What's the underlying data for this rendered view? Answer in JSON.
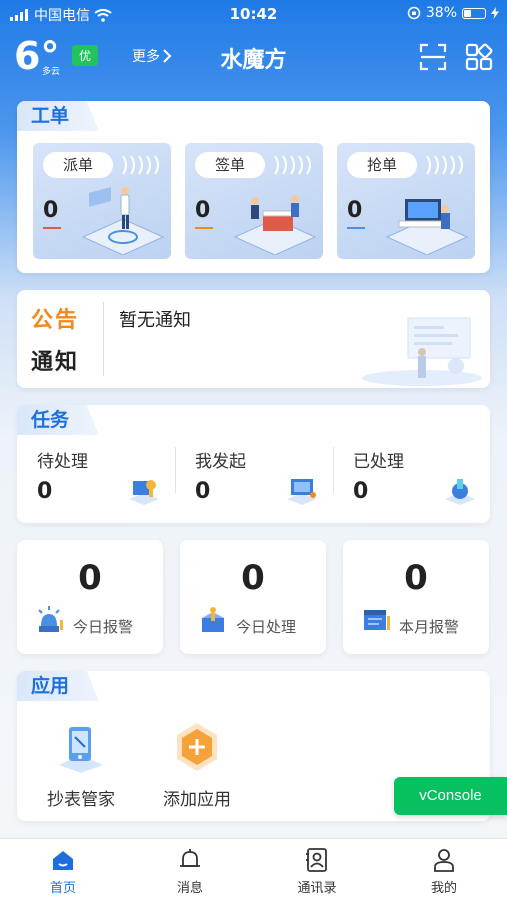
{
  "status_bar": {
    "carrier": "中国电信",
    "time": "10:42",
    "battery": "38%",
    "battery_level": 0.38
  },
  "header": {
    "temperature": "6°",
    "weather": "多云",
    "aqi": "优",
    "more": "更多",
    "title": "水魔方"
  },
  "work_orders": {
    "title": "工单",
    "items": [
      {
        "label": "派单",
        "count": "0",
        "accent": "#e05a4a"
      },
      {
        "label": "签单",
        "count": "0",
        "accent": "#f08a1c"
      },
      {
        "label": "抢单",
        "count": "0",
        "accent": "#4a90e2"
      }
    ]
  },
  "notice": {
    "title_line1": "公告",
    "title_line2": "通知",
    "text": "暂无通知"
  },
  "tasks": {
    "title": "任务",
    "items": [
      {
        "label": "待处理",
        "count": "0"
      },
      {
        "label": "我发起",
        "count": "0"
      },
      {
        "label": "已处理",
        "count": "0"
      }
    ]
  },
  "stats": [
    {
      "count": "0",
      "label": "今日报警"
    },
    {
      "count": "0",
      "label": "今日处理"
    },
    {
      "count": "0",
      "label": "本月报警"
    }
  ],
  "apps": {
    "title": "应用",
    "items": [
      {
        "label": "抄表管家"
      },
      {
        "label": "添加应用"
      }
    ]
  },
  "vconsole": "vConsole",
  "tabbar": [
    {
      "label": "首页",
      "active": true
    },
    {
      "label": "消息",
      "active": false
    },
    {
      "label": "通讯录",
      "active": false
    },
    {
      "label": "我的",
      "active": false
    }
  ],
  "colors": {
    "primary": "#1d6fde",
    "aqi_green": "#22c35e",
    "vconsole_green": "#07c160",
    "notice_orange": "#f08a1c"
  }
}
